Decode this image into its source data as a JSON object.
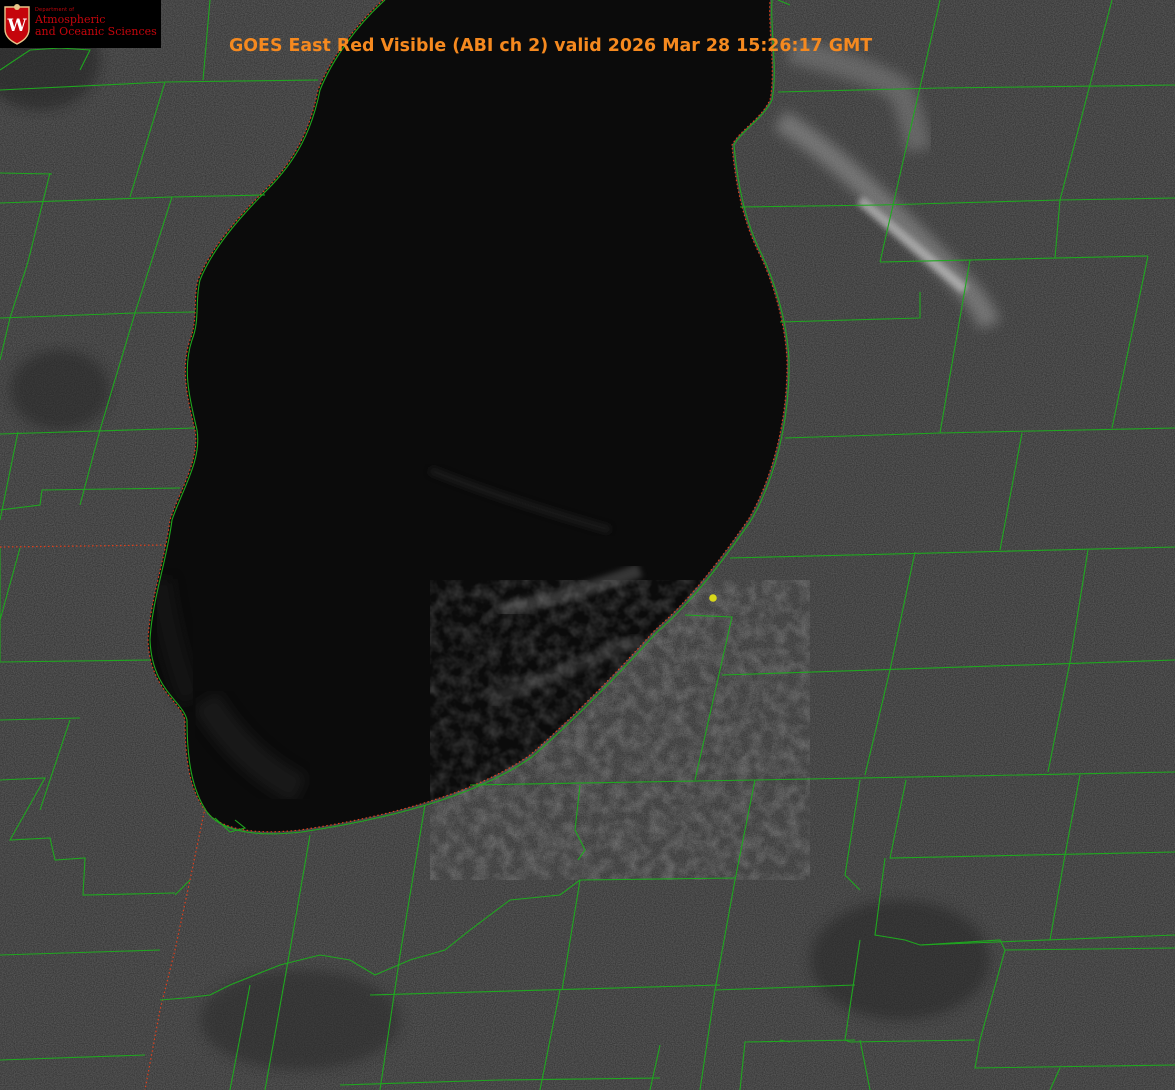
{
  "title": "GOES East Red Visible (ABI ch 2) valid 2026 Mar 28 15:26:17 GMT",
  "logo": {
    "department": "Department of",
    "line1": "Atmospheric",
    "line2": "and Oceanic Sciences",
    "seal_letter": "W"
  },
  "colors": {
    "title": "#f5891f",
    "boundaries": "#1fa81f",
    "state_line": "#e0401c",
    "marker": "#d8d81a",
    "land": "#2e2e2e",
    "lake": "#0a0a0a"
  },
  "icons": {
    "seal": "uw-crest-icon",
    "marker": "station-dot-icon"
  }
}
